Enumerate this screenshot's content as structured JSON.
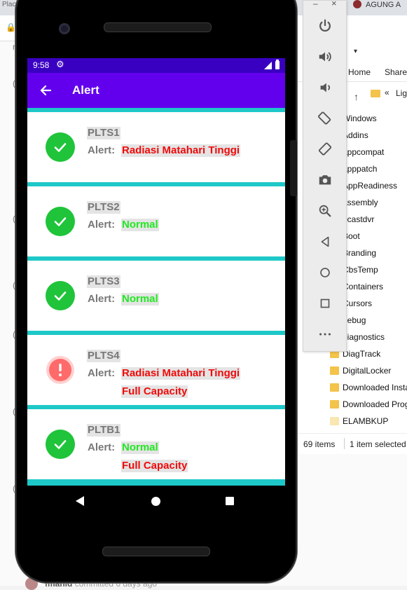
{
  "background": {
    "tab_left": "Placa (sc",
    "tab_right": "AGUNG A",
    "side_letters": [
      "r",
      "(",
      "(",
      "(",
      "(",
      "(",
      "("
    ],
    "footer_user": "fmanid",
    "footer_text": "committed 6 days ago"
  },
  "explorer": {
    "ribbon_home": "Home",
    "ribbon_share": "Share",
    "path_chevron": "«",
    "path_name": "Lig",
    "items": [
      {
        "name": "Windows",
        "pale": false
      },
      {
        "name": "Addins",
        "pale": false
      },
      {
        "name": "appcompat",
        "pale": false
      },
      {
        "name": "apppatch",
        "pale": false
      },
      {
        "name": "AppReadiness",
        "pale": false
      },
      {
        "name": "assembly",
        "pale": false
      },
      {
        "name": "bcastdvr",
        "pale": false
      },
      {
        "name": "Boot",
        "pale": false
      },
      {
        "name": "Branding",
        "pale": false
      },
      {
        "name": "CbsTemp",
        "pale": false
      },
      {
        "name": "Containers",
        "pale": false
      },
      {
        "name": "Cursors",
        "pale": false
      },
      {
        "name": "debug",
        "pale": false
      },
      {
        "name": "diagnostics",
        "pale": false
      },
      {
        "name": "DiagTrack",
        "pale": false
      },
      {
        "name": "DigitalLocker",
        "pale": false
      },
      {
        "name": "Downloaded Installations",
        "pale": false
      },
      {
        "name": "Downloaded Program Files",
        "pale": false
      },
      {
        "name": "ELAMBKUP",
        "pale": true
      }
    ],
    "item_count": "69 items",
    "selection": "1 item selected"
  },
  "emulator_toolbar": {
    "minimize_label": "–",
    "close_label": "×",
    "buttons": [
      "power-icon",
      "volume-up-icon",
      "volume-down-icon",
      "rotate-left-icon",
      "rotate-right-icon",
      "camera-icon",
      "zoom-icon",
      "back-icon",
      "home-icon",
      "overview-icon",
      "more-icon"
    ]
  },
  "phone": {
    "status_time": "9:58",
    "appbar_title": "Alert",
    "colors": {
      "statusbar": "#3a00c2",
      "appbar": "#6200ee",
      "divider": "#1ec8c8",
      "ok": "#1fc43a",
      "alert": "#ff6a6a",
      "red_text": "#f00a0a",
      "green_text": "#22e822"
    },
    "alerts": [
      {
        "name": "PLTS1",
        "label": "Alert:",
        "status": "ok",
        "lines": [
          {
            "text": "Radiasi Matahari Tinggi",
            "color": "red"
          }
        ]
      },
      {
        "name": "PLTS2",
        "label": "Alert:",
        "status": "ok",
        "lines": [
          {
            "text": "Normal",
            "color": "green"
          }
        ]
      },
      {
        "name": "PLTS3",
        "label": "Alert:",
        "status": "ok",
        "lines": [
          {
            "text": "Normal",
            "color": "green"
          }
        ]
      },
      {
        "name": "PLTS4",
        "label": "Alert:",
        "status": "alert",
        "lines": [
          {
            "text": "Radiasi Matahari Tinggi",
            "color": "red"
          },
          {
            "text": "Full Capacity",
            "color": "red"
          }
        ]
      },
      {
        "name": "PLTB1",
        "label": "Alert:",
        "status": "ok",
        "lines": [
          {
            "text": "Normal",
            "color": "green"
          },
          {
            "text": "Full Capacity",
            "color": "red"
          }
        ]
      }
    ]
  }
}
